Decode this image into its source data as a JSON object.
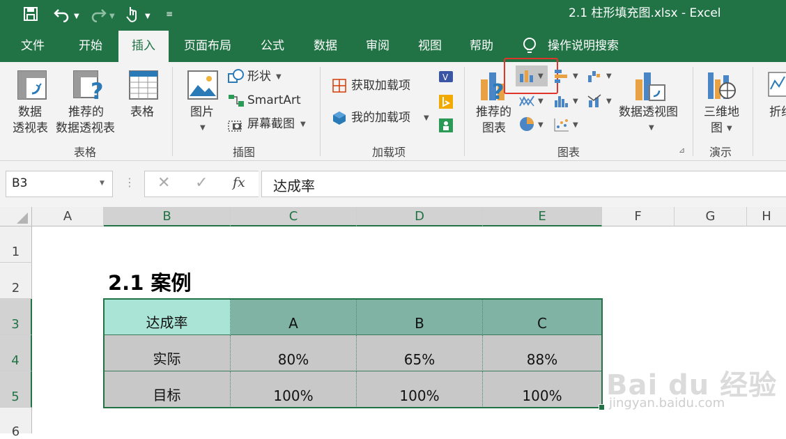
{
  "window": {
    "title": "2.1 柱形填充图.xlsx  -  Excel"
  },
  "tabs": [
    "文件",
    "开始",
    "插入",
    "页面布局",
    "公式",
    "数据",
    "审阅",
    "视图",
    "帮助",
    "操作说明搜索"
  ],
  "ribbon": {
    "pivot_line1": "数据",
    "pivot_line2": "透视表",
    "recpivot_line1": "推荐的",
    "recpivot_line2": "数据透视表",
    "table": "表格",
    "group_tables": "表格",
    "pictures": "图片",
    "shapes": "形状",
    "smartart": "SmartArt",
    "screenshot": "屏幕截图",
    "group_illustrations": "插图",
    "get_addins": "获取加载项",
    "my_addins": "我的加载项",
    "group_addins": "加载项",
    "rec_charts_line1": "推荐的",
    "rec_charts_line2": "图表",
    "pivot_chart": "数据透视图",
    "group_charts": "图表",
    "map3d_line1": "三维地",
    "map3d_line2": "图",
    "group_tours": "演示",
    "sparkline": "折线"
  },
  "formula_bar": {
    "name_box": "B3",
    "fx": "fx",
    "content": "达成率"
  },
  "columns": [
    "A",
    "B",
    "C",
    "D",
    "E",
    "F",
    "G",
    "H"
  ],
  "rows": [
    "1",
    "2",
    "3",
    "4",
    "5",
    "6"
  ],
  "sheet": {
    "heading": "2.1 案例",
    "table": {
      "header": [
        "达成率",
        "A",
        "B",
        "C"
      ],
      "rows": [
        [
          "实际",
          "80%",
          "65%",
          "88%"
        ],
        [
          "目标",
          "100%",
          "100%",
          "100%"
        ]
      ]
    }
  },
  "colors": {
    "excel_green": "#217346",
    "header_light": "#a9e4d6",
    "header_dark": "#80b3a4",
    "body_gray": "#c8c8c8",
    "highlight_box": "#e0352b"
  },
  "watermark": {
    "text": "Bai du 经验",
    "url": "jingyan.baidu.com"
  }
}
